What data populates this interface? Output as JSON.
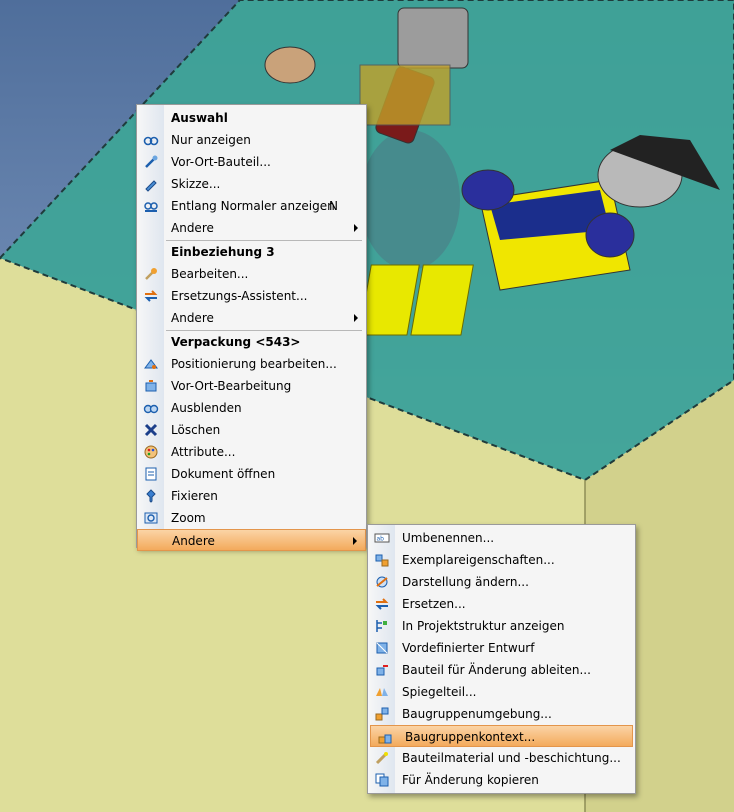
{
  "main_menu": {
    "sections": [
      {
        "header": "Auswahl",
        "items": [
          {
            "label": "Nur anzeigen",
            "icon": "eye-glasses-icon"
          },
          {
            "label": "Vor-Ort-Bauteil...",
            "icon": "tools-icon"
          },
          {
            "label": "Skizze...",
            "icon": "pencil-icon"
          },
          {
            "label": "Entlang Normaler anzeigen",
            "shortcut": "N",
            "icon": "view-normal-icon"
          },
          {
            "label": "Andere",
            "submenu": true
          }
        ]
      },
      {
        "header": "Einbeziehung 3",
        "items": [
          {
            "label": "Bearbeiten...",
            "icon": "wrench-icon"
          },
          {
            "label": "Ersetzungs-Assistent...",
            "icon": "replace-arrows-icon"
          },
          {
            "label": "Andere",
            "submenu": true
          }
        ]
      },
      {
        "header": "Verpackung <543>",
        "items": [
          {
            "label": "Positionierung bearbeiten...",
            "icon": "position-icon"
          },
          {
            "label": "Vor-Ort-Bearbeitung",
            "icon": "inplace-edit-icon"
          },
          {
            "label": "Ausblenden",
            "icon": "hide-glasses-icon"
          },
          {
            "label": "Löschen",
            "icon": "delete-x-icon"
          },
          {
            "label": "Attribute...",
            "icon": "palette-icon"
          },
          {
            "label": "Dokument öffnen",
            "icon": "open-document-icon"
          },
          {
            "label": "Fixieren",
            "icon": "pin-icon"
          },
          {
            "label": "Zoom",
            "icon": "zoom-icon"
          },
          {
            "label": "Andere",
            "submenu": true,
            "highlighted": true
          }
        ]
      }
    ]
  },
  "sub_menu": {
    "items": [
      {
        "label": "Umbenennen...",
        "icon": "rename-icon"
      },
      {
        "label": "Exemplareigenschaften...",
        "icon": "instance-properties-icon"
      },
      {
        "label": "Darstellung ändern...",
        "icon": "change-display-icon"
      },
      {
        "label": "Ersetzen...",
        "icon": "replace-icon"
      },
      {
        "label": "In Projektstruktur anzeigen",
        "icon": "tree-structure-icon"
      },
      {
        "label": "Vordefinierter Entwurf",
        "icon": "predefined-design-icon"
      },
      {
        "label": "Bauteil für Änderung ableiten...",
        "icon": "derive-part-icon"
      },
      {
        "label": "Spiegelteil...",
        "icon": "mirror-part-icon"
      },
      {
        "label": "Baugruppenumgebung...",
        "icon": "assembly-environment-icon"
      },
      {
        "label": "Baugruppenkontext...",
        "icon": "assembly-context-icon",
        "highlighted": true
      },
      {
        "label": "Bauteilmaterial und -beschichtung...",
        "icon": "material-coating-icon"
      },
      {
        "label": "Für Änderung kopieren",
        "icon": "copy-for-change-icon"
      }
    ]
  },
  "colors": {
    "highlight": "#f3aa5c",
    "menu_bg": "#f5f5f5",
    "teal_plate": "#3ea597",
    "yellow_box": "#e3e2a0"
  }
}
